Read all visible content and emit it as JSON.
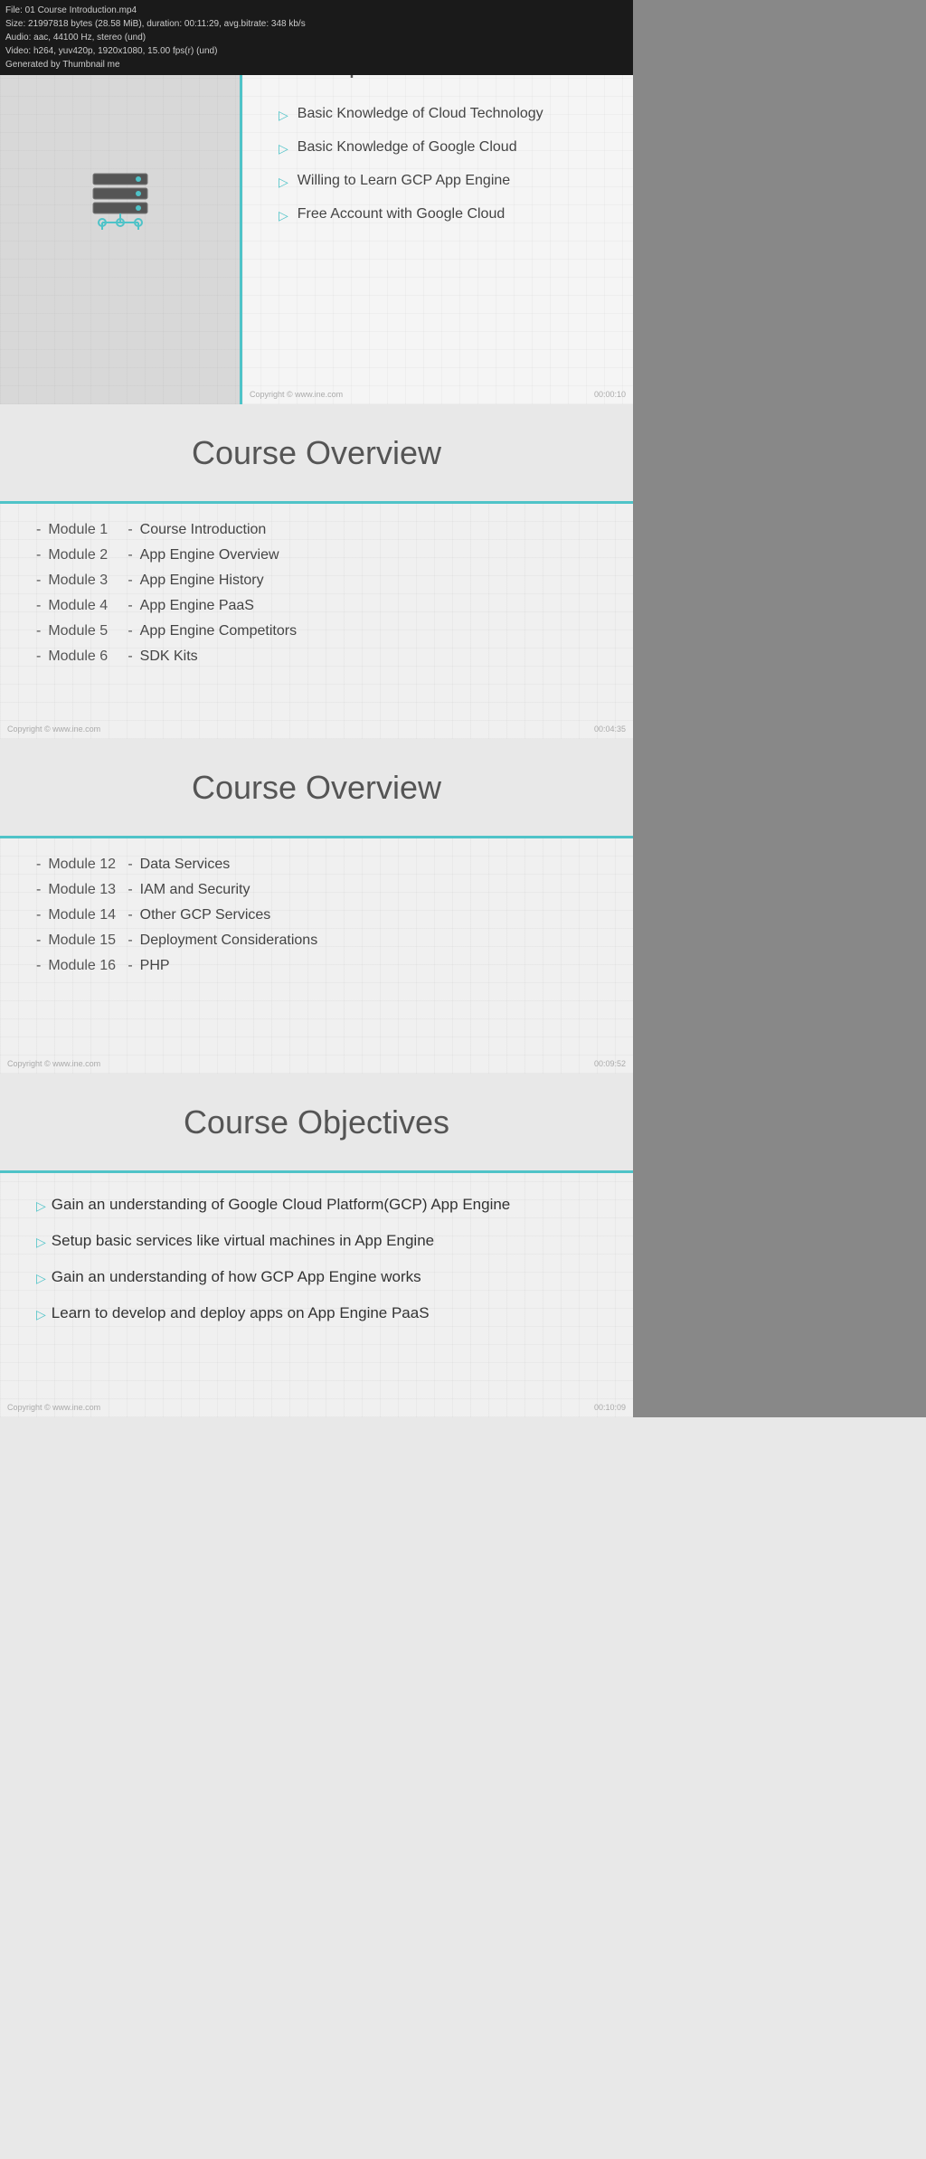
{
  "meta": {
    "filename": "File: 01 Course Introduction.mp4",
    "size_line": "Size: 21997818 bytes (28.58 MiB), duration: 00:11:29, avg.bitrate: 348 kb/s",
    "audio_line": "Audio: aac, 44100 Hz, stereo (und)",
    "video_line": "Video: h264, yuv420p, 1920x1080, 15.00 fps(r) (und)",
    "generated": "Generated by Thumbnail me"
  },
  "slide1": {
    "title": "Prerequisites",
    "items": [
      "Basic Knowledge of Cloud Technology",
      "Basic Knowledge of Google Cloud",
      "Willing to Learn GCP App Engine",
      "Free Account with Google Cloud"
    ],
    "copyright": "Copyright © www.ine.com",
    "timestamp": "00:00:10"
  },
  "slide2": {
    "title": "Course Overview",
    "modules": [
      {
        "num": "Module 1",
        "name": "Course Introduction"
      },
      {
        "num": "Module 2",
        "name": "App Engine Overview"
      },
      {
        "num": "Module 3",
        "name": "App Engine History"
      },
      {
        "num": "Module 4",
        "name": "App Engine PaaS"
      },
      {
        "num": "Module 5",
        "name": "App Engine Competitors"
      },
      {
        "num": "Module 6",
        "name": "SDK Kits"
      }
    ],
    "copyright": "Copyright © www.ine.com",
    "timestamp": "00:04:35"
  },
  "slide3": {
    "title": "Course Overview",
    "modules": [
      {
        "num": "Module 12",
        "name": "Data Services"
      },
      {
        "num": "Module 13",
        "name": "IAM and Security"
      },
      {
        "num": "Module 14",
        "name": "Other GCP Services"
      },
      {
        "num": "Module 15",
        "name": "Deployment Considerations"
      },
      {
        "num": "Module 16",
        "name": "PHP"
      }
    ],
    "copyright": "Copyright © www.ine.com",
    "timestamp": "00:09:52"
  },
  "slide4": {
    "title": "Course Objectives",
    "objectives": [
      "Gain an understanding of Google Cloud Platform(GCP) App Engine",
      "Setup basic services like virtual machines in App Engine",
      "Gain an understanding of how GCP App Engine works",
      "Learn to develop and deploy apps on App Engine PaaS"
    ],
    "copyright": "Copyright © www.ine.com",
    "timestamp": "00:10:09"
  }
}
